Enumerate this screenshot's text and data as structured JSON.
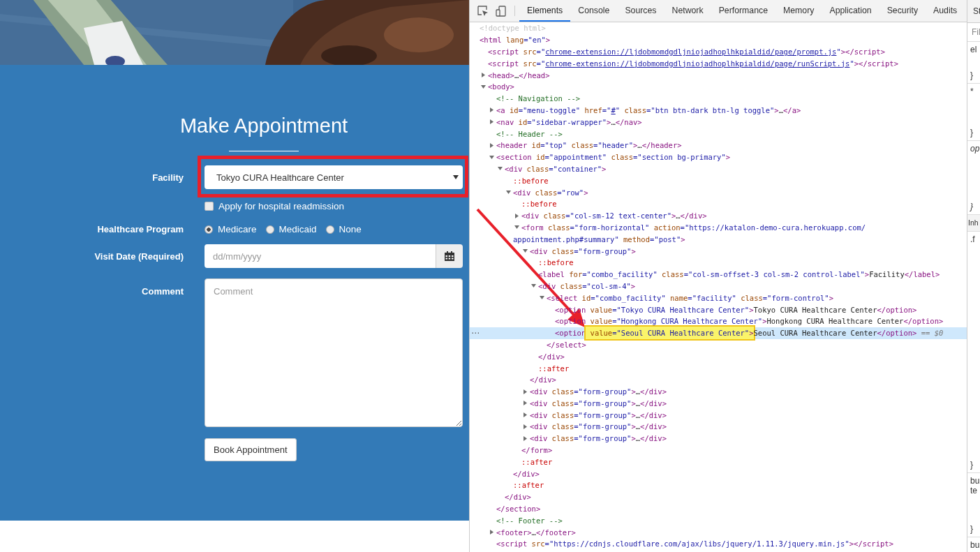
{
  "page": {
    "title": "Make Appointment",
    "facility": {
      "label": "Facility",
      "value": "Tokyo CURA Healthcare Center"
    },
    "readmission": {
      "label": "Apply for hospital readmission",
      "checked": false
    },
    "program": {
      "label": "Healthcare Program",
      "options": [
        {
          "label": "Medicare",
          "selected": true
        },
        {
          "label": "Medicaid",
          "selected": false
        },
        {
          "label": "None",
          "selected": false
        }
      ]
    },
    "visit_date": {
      "label": "Visit Date (Required)",
      "placeholder": "dd/mm/yyyy"
    },
    "comment": {
      "label": "Comment",
      "placeholder": "Comment"
    },
    "submit": "Book Appointment"
  },
  "devtools": {
    "tabs": [
      {
        "label": "Elements",
        "selected": true
      },
      {
        "label": "Console",
        "selected": false
      },
      {
        "label": "Sources",
        "selected": false
      },
      {
        "label": "Network",
        "selected": false
      },
      {
        "label": "Performance",
        "selected": false
      },
      {
        "label": "Memory",
        "selected": false
      },
      {
        "label": "Application",
        "selected": false
      },
      {
        "label": "Security",
        "selected": false
      },
      {
        "label": "Audits",
        "selected": false
      }
    ],
    "nodes": [
      {
        "parts": [
          {
            "kind": "doctype",
            "text": "<!doctype html>"
          }
        ]
      },
      {
        "parts": [
          {
            "kind": "tag",
            "text": "<html"
          },
          {
            "kind": "attr",
            "text": " lang"
          },
          {
            "kind": "val",
            "text": "=\"en\""
          },
          {
            "kind": "tag",
            "text": ">"
          }
        ],
        "children": [
          {
            "parts": [
              {
                "kind": "tag",
                "text": "<script"
              },
              {
                "kind": "attr",
                "text": " src"
              },
              {
                "kind": "val",
                "text": "=\""
              },
              {
                "kind": "link",
                "text": "chrome-extension://ljdobmomdgdljniojadhoplhkpialdid/page/prompt.js"
              },
              {
                "kind": "val",
                "text": "\""
              },
              {
                "kind": "tag",
                "text": "></script>"
              }
            ]
          },
          {
            "parts": [
              {
                "kind": "tag",
                "text": "<script"
              },
              {
                "kind": "attr",
                "text": " src"
              },
              {
                "kind": "val",
                "text": "=\""
              },
              {
                "kind": "link",
                "text": "chrome-extension://ljdobmomdgdljniojadhoplhkpialdid/page/runScript.js"
              },
              {
                "kind": "val",
                "text": "\""
              },
              {
                "kind": "tag",
                "text": "></script>"
              }
            ]
          },
          {
            "expanded": false,
            "parts": [
              {
                "kind": "tag",
                "text": "<head>"
              },
              {
                "kind": "text",
                "text": "…"
              },
              {
                "kind": "tag",
                "text": "</head>"
              }
            ]
          },
          {
            "expanded": true,
            "parts": [
              {
                "kind": "tag",
                "text": "<body>"
              }
            ],
            "children": [
              {
                "parts": [
                  {
                    "kind": "comment",
                    "text": "<!-- Navigation -->"
                  }
                ]
              },
              {
                "expanded": false,
                "parts": [
                  {
                    "kind": "tag",
                    "text": "<a"
                  },
                  {
                    "kind": "attr",
                    "text": " id"
                  },
                  {
                    "kind": "val",
                    "text": "=\"menu-toggle\""
                  },
                  {
                    "kind": "attr",
                    "text": " href"
                  },
                  {
                    "kind": "val",
                    "text": "=\""
                  },
                  {
                    "kind": "link",
                    "text": "#"
                  },
                  {
                    "kind": "val",
                    "text": "\""
                  },
                  {
                    "kind": "attr",
                    "text": " class"
                  },
                  {
                    "kind": "val",
                    "text": "=\"btn btn-dark btn-lg toggle\""
                  },
                  {
                    "kind": "tag",
                    "text": ">"
                  },
                  {
                    "kind": "text",
                    "text": "…"
                  },
                  {
                    "kind": "tag",
                    "text": "</a>"
                  }
                ]
              },
              {
                "expanded": false,
                "parts": [
                  {
                    "kind": "tag",
                    "text": "<nav"
                  },
                  {
                    "kind": "attr",
                    "text": " id"
                  },
                  {
                    "kind": "val",
                    "text": "=\"sidebar-wrapper\""
                  },
                  {
                    "kind": "tag",
                    "text": ">"
                  },
                  {
                    "kind": "text",
                    "text": "…"
                  },
                  {
                    "kind": "tag",
                    "text": "</nav>"
                  }
                ]
              },
              {
                "parts": [
                  {
                    "kind": "comment",
                    "text": "<!-- Header -->"
                  }
                ]
              },
              {
                "expanded": false,
                "parts": [
                  {
                    "kind": "tag",
                    "text": "<header"
                  },
                  {
                    "kind": "attr",
                    "text": " id"
                  },
                  {
                    "kind": "val",
                    "text": "=\"top\""
                  },
                  {
                    "kind": "attr",
                    "text": " class"
                  },
                  {
                    "kind": "val",
                    "text": "=\"header\""
                  },
                  {
                    "kind": "tag",
                    "text": ">"
                  },
                  {
                    "kind": "text",
                    "text": "…"
                  },
                  {
                    "kind": "tag",
                    "text": "</header>"
                  }
                ]
              },
              {
                "expanded": true,
                "parts": [
                  {
                    "kind": "tag",
                    "text": "<section"
                  },
                  {
                    "kind": "attr",
                    "text": " id"
                  },
                  {
                    "kind": "val",
                    "text": "=\"appointment\""
                  },
                  {
                    "kind": "attr",
                    "text": " class"
                  },
                  {
                    "kind": "val",
                    "text": "=\"section bg-primary\""
                  },
                  {
                    "kind": "tag",
                    "text": ">"
                  }
                ],
                "close": [
                  {
                    "kind": "tag",
                    "text": "</section>"
                  }
                ],
                "children": [
                  {
                    "expanded": true,
                    "parts": [
                      {
                        "kind": "tag",
                        "text": "<div"
                      },
                      {
                        "kind": "attr",
                        "text": " class"
                      },
                      {
                        "kind": "val",
                        "text": "=\"container\""
                      },
                      {
                        "kind": "tag",
                        "text": ">"
                      }
                    ],
                    "close": [
                      {
                        "kind": "tag",
                        "text": "</div>"
                      }
                    ],
                    "children": [
                      {
                        "parts": [
                          {
                            "kind": "pseudo",
                            "text": "::before"
                          }
                        ]
                      },
                      {
                        "expanded": true,
                        "parts": [
                          {
                            "kind": "tag",
                            "text": "<div"
                          },
                          {
                            "kind": "attr",
                            "text": " class"
                          },
                          {
                            "kind": "val",
                            "text": "=\"row\""
                          },
                          {
                            "kind": "tag",
                            "text": ">"
                          }
                        ],
                        "close": [
                          {
                            "kind": "tag",
                            "text": "</div>"
                          }
                        ],
                        "children": [
                          {
                            "parts": [
                              {
                                "kind": "pseudo",
                                "text": "::before"
                              }
                            ]
                          },
                          {
                            "expanded": false,
                            "parts": [
                              {
                                "kind": "tag",
                                "text": "<div"
                              },
                              {
                                "kind": "attr",
                                "text": " class"
                              },
                              {
                                "kind": "val",
                                "text": "=\"col-sm-12 text-center\""
                              },
                              {
                                "kind": "tag",
                                "text": ">"
                              },
                              {
                                "kind": "text",
                                "text": "…"
                              },
                              {
                                "kind": "tag",
                                "text": "</div>"
                              }
                            ]
                          },
                          {
                            "expanded": true,
                            "parts": [
                              {
                                "kind": "tag",
                                "text": "<form"
                              },
                              {
                                "kind": "attr",
                                "text": " class"
                              },
                              {
                                "kind": "val",
                                "text": "=\"form-horizontal\""
                              },
                              {
                                "kind": "attr",
                                "text": " action"
                              },
                              {
                                "kind": "val",
                                "text": "=\"https://katalon-demo-cura.herokuapp.com/"
                              }
                            ],
                            "wrap": [
                              {
                                "kind": "val",
                                "text": "appointment.php#summary\""
                              },
                              {
                                "kind": "attr",
                                "text": " method"
                              },
                              {
                                "kind": "val",
                                "text": "=\"post\""
                              },
                              {
                                "kind": "tag",
                                "text": ">"
                              }
                            ],
                            "close": [
                              {
                                "kind": "tag",
                                "text": "</form>"
                              }
                            ],
                            "children": [
                              {
                                "expanded": true,
                                "parts": [
                                  {
                                    "kind": "tag",
                                    "text": "<div"
                                  },
                                  {
                                    "kind": "attr",
                                    "text": " class"
                                  },
                                  {
                                    "kind": "val",
                                    "text": "=\"form-group\""
                                  },
                                  {
                                    "kind": "tag",
                                    "text": ">"
                                  }
                                ],
                                "close": [
                                  {
                                    "kind": "tag",
                                    "text": "</div>"
                                  }
                                ],
                                "children": [
                                  {
                                    "parts": [
                                      {
                                        "kind": "pseudo",
                                        "text": "::before"
                                      }
                                    ]
                                  },
                                  {
                                    "parts": [
                                      {
                                        "kind": "tag",
                                        "text": "<label"
                                      },
                                      {
                                        "kind": "attr",
                                        "text": " for"
                                      },
                                      {
                                        "kind": "val",
                                        "text": "=\"combo_facility\""
                                      },
                                      {
                                        "kind": "attr",
                                        "text": " class"
                                      },
                                      {
                                        "kind": "val",
                                        "text": "=\"col-sm-offset-3 col-sm-2 control-label\""
                                      },
                                      {
                                        "kind": "tag",
                                        "text": ">"
                                      },
                                      {
                                        "kind": "text",
                                        "text": "Facility"
                                      },
                                      {
                                        "kind": "tag",
                                        "text": "</label>"
                                      }
                                    ]
                                  },
                                  {
                                    "expanded": true,
                                    "parts": [
                                      {
                                        "kind": "tag",
                                        "text": "<div"
                                      },
                                      {
                                        "kind": "attr",
                                        "text": " class"
                                      },
                                      {
                                        "kind": "val",
                                        "text": "=\"col-sm-4\""
                                      },
                                      {
                                        "kind": "tag",
                                        "text": ">"
                                      }
                                    ],
                                    "close": [
                                      {
                                        "kind": "tag",
                                        "text": "</div>"
                                      }
                                    ],
                                    "children": [
                                      {
                                        "expanded": true,
                                        "parts": [
                                          {
                                            "kind": "tag",
                                            "text": "<select"
                                          },
                                          {
                                            "kind": "attr",
                                            "text": " id"
                                          },
                                          {
                                            "kind": "val",
                                            "text": "=\"combo_facility\""
                                          },
                                          {
                                            "kind": "attr",
                                            "text": " name"
                                          },
                                          {
                                            "kind": "val",
                                            "text": "=\"facility\""
                                          },
                                          {
                                            "kind": "attr",
                                            "text": " class"
                                          },
                                          {
                                            "kind": "val",
                                            "text": "=\"form-control\""
                                          },
                                          {
                                            "kind": "tag",
                                            "text": ">"
                                          }
                                        ],
                                        "close": [
                                          {
                                            "kind": "tag",
                                            "text": "</select>"
                                          }
                                        ],
                                        "children": [
                                          {
                                            "selected": false,
                                            "parts": [
                                              {
                                                "kind": "tag",
                                                "text": "<option"
                                              },
                                              {
                                                "kind": "attr",
                                                "text": " value"
                                              },
                                              {
                                                "kind": "val",
                                                "text": "=\"Tokyo CURA Healthcare Center\""
                                              },
                                              {
                                                "kind": "tag",
                                                "text": ">"
                                              },
                                              {
                                                "kind": "text",
                                                "text": "Tokyo CURA Healthcare Center"
                                              },
                                              {
                                                "kind": "tag",
                                                "text": "</option>"
                                              }
                                            ]
                                          },
                                          {
                                            "selected": false,
                                            "parts": [
                                              {
                                                "kind": "tag",
                                                "text": "<option"
                                              },
                                              {
                                                "kind": "attr",
                                                "text": " value"
                                              },
                                              {
                                                "kind": "val",
                                                "text": "=\"Hongkong CURA Healthcare Center\""
                                              },
                                              {
                                                "kind": "tag",
                                                "text": ">"
                                              },
                                              {
                                                "kind": "text",
                                                "text": "Hongkong CURA Healthcare Center"
                                              },
                                              {
                                                "kind": "tag",
                                                "text": "</option>"
                                              }
                                            ]
                                          },
                                          {
                                            "selected": true,
                                            "marker": "⋯",
                                            "parts": [
                                              {
                                                "kind": "tag",
                                                "text": "<option"
                                              },
                                              {
                                                "kind": "attr",
                                                "text": " value",
                                                "marked": true
                                              },
                                              {
                                                "kind": "val",
                                                "text": "=\"Seoul CURA Healthcare Center\"",
                                                "marked": true
                                              },
                                              {
                                                "kind": "tag",
                                                "text": ">",
                                                "marked": true
                                              },
                                              {
                                                "kind": "text",
                                                "text": "Seoul CURA Healthcare Center"
                                              },
                                              {
                                                "kind": "tag",
                                                "text": "</option>"
                                              },
                                              {
                                                "kind": "ref",
                                                "text": " == $0"
                                              }
                                            ]
                                          }
                                        ]
                                      }
                                    ]
                                  },
                                  {
                                    "parts": [
                                      {
                                        "kind": "pseudo",
                                        "text": "::after"
                                      }
                                    ]
                                  }
                                ]
                              },
                              {
                                "expanded": false,
                                "parts": [
                                  {
                                    "kind": "tag",
                                    "text": "<div"
                                  },
                                  {
                                    "kind": "attr",
                                    "text": " class"
                                  },
                                  {
                                    "kind": "val",
                                    "text": "=\"form-group\""
                                  },
                                  {
                                    "kind": "tag",
                                    "text": ">"
                                  },
                                  {
                                    "kind": "text",
                                    "text": "…"
                                  },
                                  {
                                    "kind": "tag",
                                    "text": "</div>"
                                  }
                                ]
                              },
                              {
                                "expanded": false,
                                "parts": [
                                  {
                                    "kind": "tag",
                                    "text": "<div"
                                  },
                                  {
                                    "kind": "attr",
                                    "text": " class"
                                  },
                                  {
                                    "kind": "val",
                                    "text": "=\"form-group\""
                                  },
                                  {
                                    "kind": "tag",
                                    "text": ">"
                                  },
                                  {
                                    "kind": "text",
                                    "text": "…"
                                  },
                                  {
                                    "kind": "tag",
                                    "text": "</div>"
                                  }
                                ]
                              },
                              {
                                "expanded": false,
                                "parts": [
                                  {
                                    "kind": "tag",
                                    "text": "<div"
                                  },
                                  {
                                    "kind": "attr",
                                    "text": " class"
                                  },
                                  {
                                    "kind": "val",
                                    "text": "=\"form-group\""
                                  },
                                  {
                                    "kind": "tag",
                                    "text": ">"
                                  },
                                  {
                                    "kind": "text",
                                    "text": "…"
                                  },
                                  {
                                    "kind": "tag",
                                    "text": "</div>"
                                  }
                                ]
                              },
                              {
                                "expanded": false,
                                "parts": [
                                  {
                                    "kind": "tag",
                                    "text": "<div"
                                  },
                                  {
                                    "kind": "attr",
                                    "text": " class"
                                  },
                                  {
                                    "kind": "val",
                                    "text": "=\"form-group\""
                                  },
                                  {
                                    "kind": "tag",
                                    "text": ">"
                                  },
                                  {
                                    "kind": "text",
                                    "text": "…"
                                  },
                                  {
                                    "kind": "tag",
                                    "text": "</div>"
                                  }
                                ]
                              },
                              {
                                "expanded": false,
                                "parts": [
                                  {
                                    "kind": "tag",
                                    "text": "<div"
                                  },
                                  {
                                    "kind": "attr",
                                    "text": " class"
                                  },
                                  {
                                    "kind": "val",
                                    "text": "=\"form-group\""
                                  },
                                  {
                                    "kind": "tag",
                                    "text": ">"
                                  },
                                  {
                                    "kind": "text",
                                    "text": "…"
                                  },
                                  {
                                    "kind": "tag",
                                    "text": "</div>"
                                  }
                                ]
                              }
                            ]
                          },
                          {
                            "parts": [
                              {
                                "kind": "pseudo",
                                "text": "::after"
                              }
                            ]
                          }
                        ]
                      },
                      {
                        "parts": [
                          {
                            "kind": "pseudo",
                            "text": "::after"
                          }
                        ]
                      }
                    ]
                  }
                ]
              },
              {
                "parts": [
                  {
                    "kind": "comment",
                    "text": "<!-- Footer -->"
                  }
                ]
              },
              {
                "expanded": false,
                "parts": [
                  {
                    "kind": "tag",
                    "text": "<footer>"
                  },
                  {
                    "kind": "text",
                    "text": "…"
                  },
                  {
                    "kind": "tag",
                    "text": "</footer>"
                  }
                ]
              },
              {
                "parts": [
                  {
                    "kind": "tag",
                    "text": "<script"
                  },
                  {
                    "kind": "attr",
                    "text": " src"
                  },
                  {
                    "kind": "val",
                    "text": "=\"https://cdnjs.cloudflare.com/ajax/libs/jquery/1.11.3/jquery.min.js\""
                  },
                  {
                    "kind": "tag",
                    "text": "></script>"
                  }
                ]
              }
            ]
          }
        ]
      }
    ],
    "styles_pane": {
      "tab": "St",
      "filter": "Fil",
      "blocks": [
        {
          "kind": "rule",
          "lines": [
            "el"
          ],
          "close": "}"
        },
        {
          "kind": "rule",
          "lines": [
            "*"
          ],
          "close": "}"
        },
        {
          "kind": "rule",
          "lines": [
            "op"
          ],
          "close": "}"
        },
        {
          "kind": "header",
          "lines": [
            "Inh"
          ]
        },
        {
          "kind": "rule",
          "lines": [
            ".f"
          ],
          "close": "}"
        },
        {
          "kind": "rule",
          "lines": [
            "bu",
            "te"
          ],
          "close": "}"
        },
        {
          "kind": "rule",
          "lines": [
            "bu"
          ]
        }
      ]
    }
  },
  "annotations": {
    "frame": true,
    "arrow": true
  }
}
